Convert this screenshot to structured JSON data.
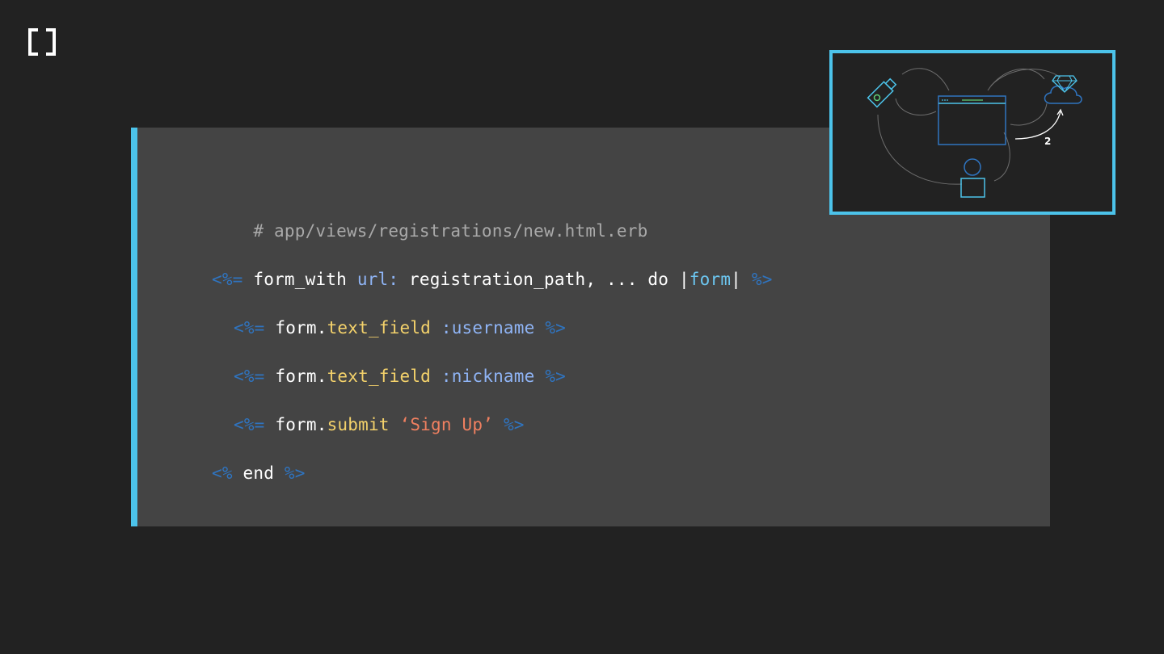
{
  "icons": {
    "logo": "bracket-logo-icon",
    "usb": "usb-key-icon",
    "browser": "browser-window-icon",
    "gem_cloud": "ruby-gem-cloud-icon",
    "user": "user-icon"
  },
  "colors": {
    "background": "#222222",
    "panel": "#444444",
    "accent": "#4cc3ea",
    "comment": "#a9a9a9",
    "erb_delimiter": "#2f74c0",
    "keyword": "#8fb4f5",
    "method": "#f4d26b",
    "string": "#f08060",
    "block_param": "#6cc6f0"
  },
  "code": {
    "comment": "# app/views/registrations/new.html.erb",
    "line1": {
      "open": "<%=",
      "method": "form_with",
      "kw": "url:",
      "args": "registration_path, ... do |",
      "param": "form",
      "pipe": "|",
      "close": "%>"
    },
    "line2": {
      "open": "<%=",
      "receiver": "form.",
      "method": "text_field",
      "symbol": ":username",
      "close": "%>"
    },
    "line3": {
      "open": "<%=",
      "receiver": "form.",
      "method": "text_field",
      "symbol": ":nickname",
      "close": "%>"
    },
    "line4": {
      "open": "<%=",
      "receiver": "form.",
      "method": "submit",
      "string": "‘Sign Up’",
      "close": "%>"
    },
    "line5": {
      "open": "<%",
      "keyword": "end",
      "close": "%>"
    }
  },
  "diagram": {
    "step_number": "2"
  }
}
